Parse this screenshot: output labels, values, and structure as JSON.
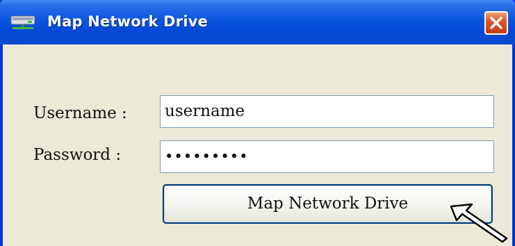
{
  "window": {
    "title": "Map Network Drive",
    "title_icon": "network-drive-icon",
    "close_icon": "close-icon"
  },
  "form": {
    "username_label": "Username :",
    "username_value": "username",
    "password_label": "Password :",
    "password_value": "•••••••••",
    "submit_label": "Map Network Drive"
  },
  "colors": {
    "titlebar": "#0a56e0",
    "close_button": "#e2562a",
    "window_bg": "#ece9d8"
  }
}
